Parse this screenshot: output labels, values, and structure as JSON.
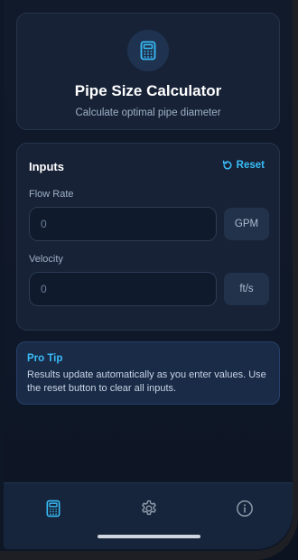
{
  "header": {
    "title": "Pipe Size Calculator",
    "subtitle": "Calculate optimal pipe diameter",
    "icon": "calculator-icon"
  },
  "inputs": {
    "title": "Inputs",
    "reset_label": "Reset",
    "fields": [
      {
        "label": "Flow Rate",
        "value": "",
        "placeholder": "0",
        "unit": "GPM"
      },
      {
        "label": "Velocity",
        "value": "",
        "placeholder": "0",
        "unit": "ft/s"
      }
    ]
  },
  "tip": {
    "title": "Pro Tip",
    "text": "Results update automatically as you enter values. Use the reset button to clear all inputs."
  },
  "nav": {
    "items": [
      {
        "icon": "calculator-icon",
        "active": true
      },
      {
        "icon": "gear-icon",
        "active": false
      },
      {
        "icon": "info-icon",
        "active": false
      }
    ]
  },
  "colors": {
    "accent": "#38bdf8",
    "background": "#0f1828",
    "card": "#172236",
    "tip_background": "#1a2b47",
    "nav_inactive": "#8b97a8"
  }
}
